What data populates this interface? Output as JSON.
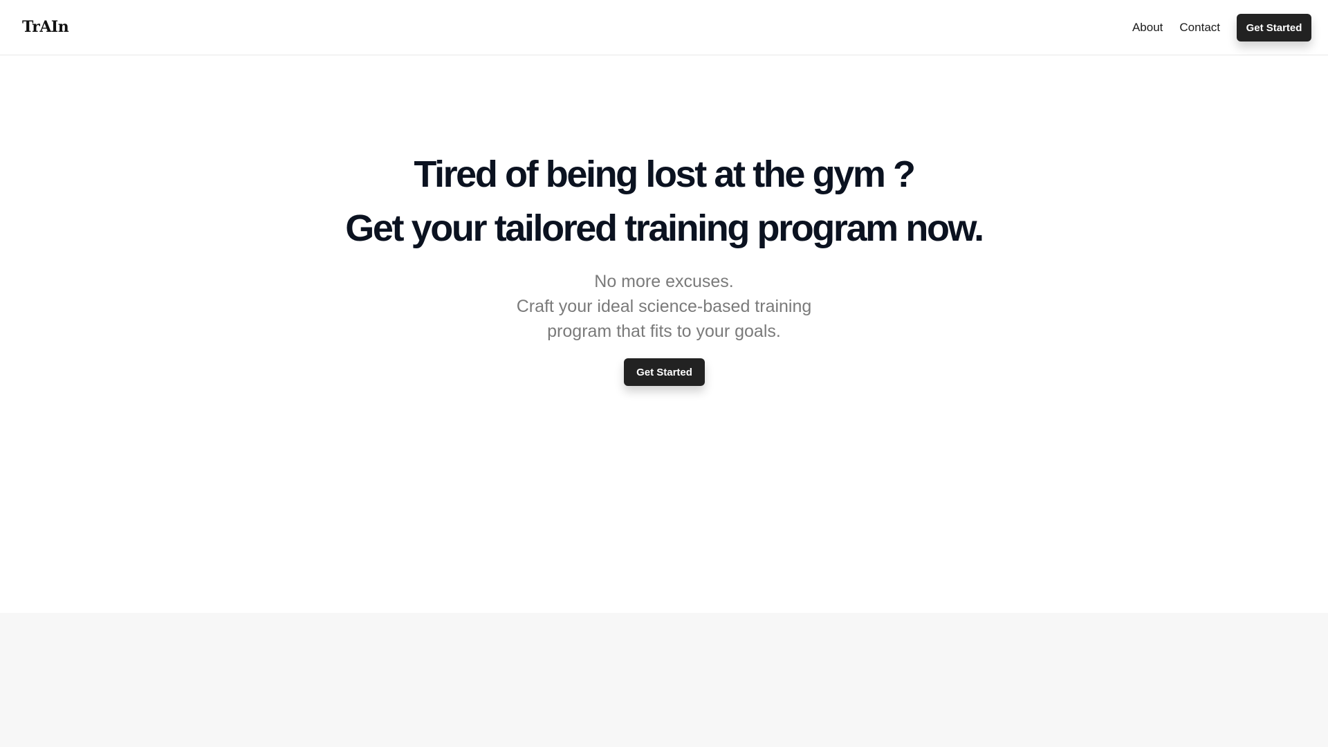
{
  "header": {
    "logo": "TrAIn",
    "nav": {
      "about": "About",
      "contact": "Contact",
      "cta": "Get Started"
    }
  },
  "hero": {
    "headline_1": "Tired of being lost at the gym ?",
    "headline_2": "Get your tailored training program now.",
    "sub_1": "No more excuses.",
    "sub_2": "Craft your ideal science-based training",
    "sub_3": "program that fits to your goals.",
    "cta": "Get Started"
  },
  "colors": {
    "button": "#222222",
    "headline": "#0b1220",
    "subtext": "#7a7a7a",
    "band": "#f7f7f7"
  }
}
